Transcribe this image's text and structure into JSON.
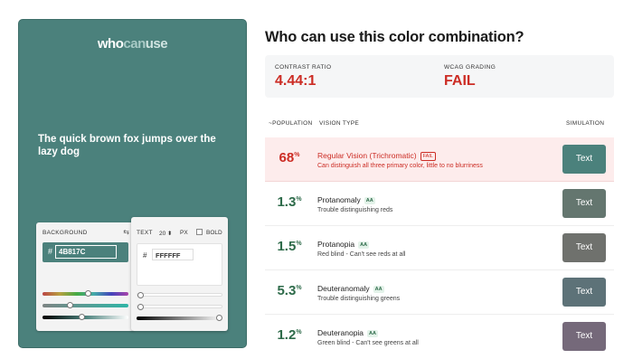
{
  "logo": {
    "who": "who",
    "can": "can",
    "use": "use"
  },
  "preview": {
    "sample_text": "The quick brown fox jumps over the lazy dog",
    "background_color": "#4B817C",
    "text_color": "#FFFFFF"
  },
  "background_card": {
    "label": "BACKGROUND",
    "hash": "#",
    "hex": "4B817C",
    "swap_icon": "swap-arrows-icon"
  },
  "text_card": {
    "label": "TEXT",
    "size": "20 ⬍",
    "unit": "PX",
    "bold_label": "BOLD",
    "hash": "#",
    "hex": "FFFFFF"
  },
  "title": "Who can use this color combination?",
  "stats": {
    "contrast_label": "CONTRAST RATIO",
    "contrast_value": "4.44:1",
    "grading_label": "WCAG GRADING",
    "grading_value": "FAIL"
  },
  "columns": {
    "population": "~POPULATION",
    "vision": "VISION TYPE",
    "simulation": "SIMULATION"
  },
  "rows": [
    {
      "pct": "68",
      "pct_sym": "%",
      "name": "Regular Vision (Trichromatic)",
      "badge": "FAIL",
      "desc": "Can distinguish all three primary color, little to no blurriness",
      "sim_label": "Text",
      "sim_color": "#4B817C"
    },
    {
      "pct": "1.3",
      "pct_sym": "%",
      "name": "Protanomaly",
      "badge": "AA",
      "desc": "Trouble distinguishing reds",
      "sim_label": "Text",
      "sim_color": "#64766F"
    },
    {
      "pct": "1.5",
      "pct_sym": "%",
      "name": "Protanopia",
      "badge": "AA",
      "desc": "Red blind - Can't see reds at all",
      "sim_label": "Text",
      "sim_color": "#6F716D"
    },
    {
      "pct": "5.3",
      "pct_sym": "%",
      "name": "Deuteranomaly",
      "badge": "AA",
      "desc": "Trouble distinguishing greens",
      "sim_label": "Text",
      "sim_color": "#5D7278"
    },
    {
      "pct": "1.2",
      "pct_sym": "%",
      "name": "Deuteranopia",
      "badge": "AA",
      "desc": "Green blind - Can't see greens at all",
      "sim_label": "Text",
      "sim_color": "#75697A"
    }
  ],
  "colors": {
    "fail_red": "#cc2d25",
    "pass_green": "#2e6b4a",
    "accent": "#4B817C"
  }
}
